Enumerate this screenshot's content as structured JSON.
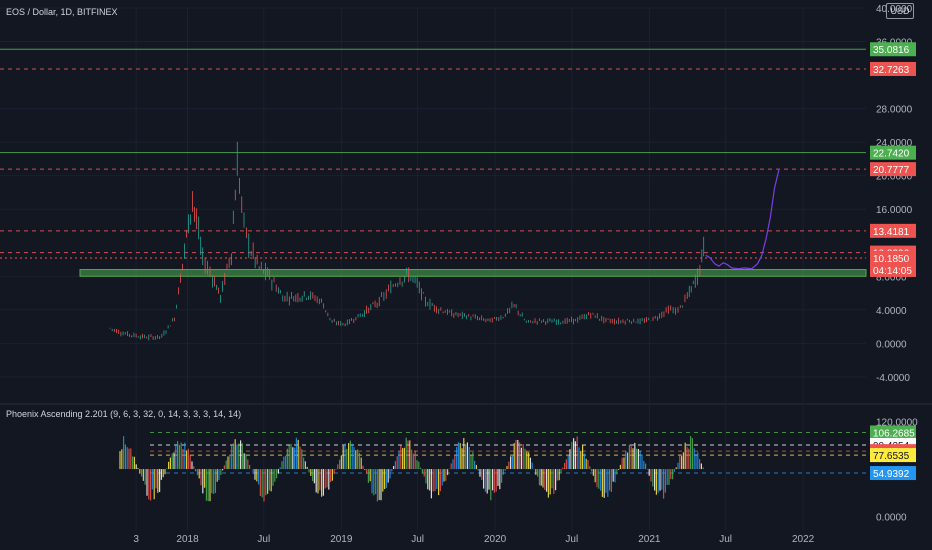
{
  "header": {
    "symbol_title": "EOS / Dollar, 1D, BITFINEX",
    "currency_button": "USD",
    "indicator_title": "Phoenix Ascending 2.201 (9, 6, 3, 32, 0, 14, 3, 3, 3, 14, 14)"
  },
  "colors": {
    "background": "#131722",
    "up": "#26a69a",
    "down": "#ef5350",
    "support_line": "#4caf50",
    "resistance_line": "#ef5350",
    "zone": "#4caf50",
    "projection": "#7b3fe4"
  },
  "chart_data": [
    {
      "type": "line",
      "title": "EOS / Dollar, 1D, BITFINEX",
      "y_ticks": [
        "40.0000",
        "36.0000",
        "28.0000",
        "24.0000",
        "20.0000",
        "16.0000",
        "8.0000",
        "4.0000",
        "0.0000",
        "-4.0000"
      ],
      "x_ticks": [
        "3",
        "2018",
        "Jul",
        "2019",
        "Jul",
        "2020",
        "Jul",
        "2021",
        "Jul",
        "2022"
      ],
      "ylim": [
        -7,
        40
      ],
      "price_series": {
        "x": [
          "2017-07-01",
          "2017-08-01",
          "2017-09-01",
          "2017-10-01",
          "2017-11-01",
          "2017-12-01",
          "2017-12-20",
          "2018-01-13",
          "2018-02-06",
          "2018-03-01",
          "2018-03-20",
          "2018-04-15",
          "2018-04-29",
          "2018-05-15",
          "2018-06-01",
          "2018-06-20",
          "2018-07-15",
          "2018-08-15",
          "2018-09-10",
          "2018-10-15",
          "2018-11-15",
          "2018-12-10",
          "2019-01-10",
          "2019-02-20",
          "2019-04-01",
          "2019-05-15",
          "2019-06-10",
          "2019-06-30",
          "2019-07-20",
          "2019-08-15",
          "2019-09-20",
          "2019-10-20",
          "2019-11-20",
          "2019-12-20",
          "2020-01-20",
          "2020-02-15",
          "2020-03-15",
          "2020-04-15",
          "2020-05-15",
          "2020-06-15",
          "2020-07-15",
          "2020-08-15",
          "2020-09-15",
          "2020-10-15",
          "2020-11-15",
          "2020-12-15",
          "2021-01-15",
          "2021-02-15",
          "2021-03-10",
          "2021-04-01",
          "2021-04-20",
          "2021-05-01",
          "2021-05-10",
          "2021-05-13"
        ],
        "close": [
          1.8,
          1.2,
          0.9,
          0.7,
          0.8,
          3.0,
          9.5,
          17.5,
          10.0,
          8.0,
          5.5,
          11.0,
          21.5,
          14.0,
          11.0,
          9.0,
          8.0,
          5.5,
          5.5,
          5.8,
          5.0,
          2.5,
          2.3,
          3.5,
          5.0,
          7.5,
          8.2,
          7.0,
          5.0,
          4.2,
          3.5,
          3.3,
          3.0,
          2.7,
          3.2,
          4.5,
          2.5,
          2.7,
          2.6,
          2.6,
          2.8,
          3.5,
          2.8,
          2.6,
          2.7,
          2.6,
          3.0,
          4.0,
          3.9,
          5.5,
          7.5,
          9.0,
          11.5,
          10.2
        ]
      },
      "projection_series": {
        "x": [
          "2021-05-15",
          "2021-05-25",
          "2021-06-05",
          "2021-06-15",
          "2021-06-25",
          "2021-07-05",
          "2021-07-15",
          "2021-08-01",
          "2021-08-15",
          "2021-09-01",
          "2021-09-15",
          "2021-09-25",
          "2021-10-05",
          "2021-10-15",
          "2021-10-25",
          "2021-11-05"
        ],
        "y": [
          10.5,
          10.2,
          9.5,
          9.2,
          9.6,
          9.4,
          9.0,
          8.9,
          9.0,
          8.9,
          9.5,
          10.5,
          12.5,
          15.0,
          18.5,
          20.8
        ]
      },
      "support_zone": [
        8.0,
        8.8
      ],
      "horizontal_levels": [
        {
          "label": "35.0816",
          "color": "#4caf50",
          "style": "solid"
        },
        {
          "label": "32.7263",
          "color": "#ef5350",
          "style": "dashed"
        },
        {
          "label": "22.7420",
          "color": "#4caf50",
          "style": "solid"
        },
        {
          "label": "20.7777",
          "color": "#ef5350",
          "style": "dashed"
        },
        {
          "label": "13.4181",
          "color": "#ef5350",
          "style": "dashed"
        },
        {
          "label": "10.8206",
          "color": "#ef5350",
          "style": "dashed"
        }
      ],
      "current_price": {
        "label": "10.1850",
        "countdown": "04:14:05"
      }
    },
    {
      "type": "line",
      "title": "Phoenix Ascending 2.201 (9, 6, 3, 32, 0, 14, 3, 3, 3, 14, 14)",
      "y_ticks": [
        "120.0000",
        "0.0000"
      ],
      "ylim": [
        -12,
        122
      ],
      "oscillator_range": [
        10,
        110
      ],
      "horizontal_levels": [
        {
          "label": "106.2685",
          "color": "#4caf50",
          "style": "dashed"
        },
        {
          "label": "90.4354",
          "color": "#ffffff",
          "style": "dashed"
        },
        {
          "label": "82.6535",
          "color": "#ef5350",
          "style": "dashed"
        },
        {
          "label": "77.6535",
          "color": "#ffeb3b",
          "style": "dashed"
        },
        {
          "label": "54.9392",
          "color": "#2196f3",
          "style": "dashed"
        }
      ]
    }
  ]
}
